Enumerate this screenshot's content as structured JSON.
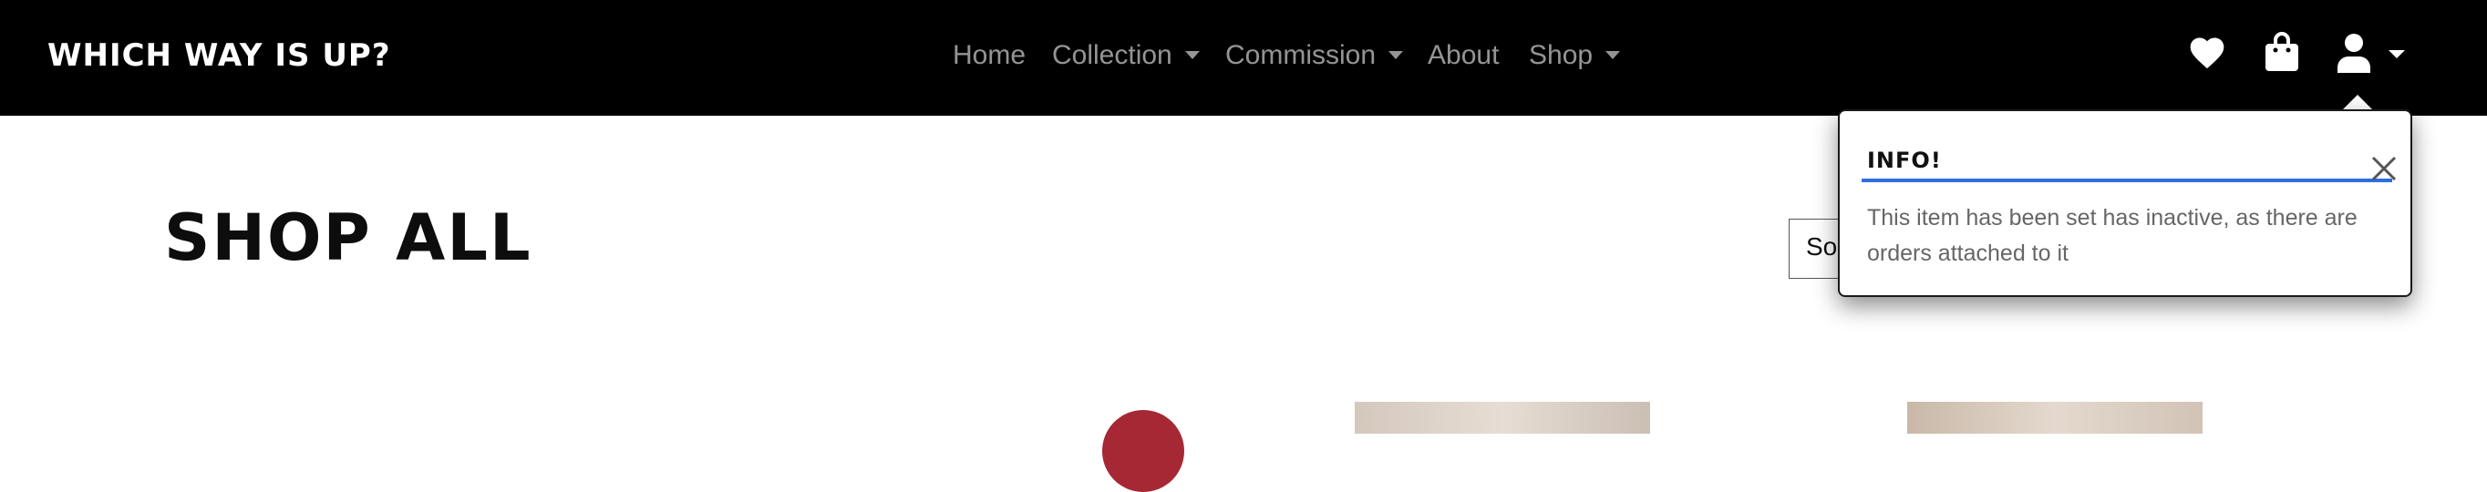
{
  "navbar": {
    "brand": "Which Way Is Up?",
    "links": [
      {
        "label": "Home",
        "dropdown": false
      },
      {
        "label": "Collection",
        "dropdown": true
      },
      {
        "label": "Commission",
        "dropdown": true
      },
      {
        "label": "About",
        "dropdown": false
      },
      {
        "label": "Shop",
        "dropdown": true
      }
    ],
    "icons": [
      "heart-icon",
      "shopping-bag-icon",
      "user-icon"
    ]
  },
  "page": {
    "title": "Shop All",
    "sort_select_visible_text": "So"
  },
  "toast": {
    "title": "Info!",
    "message": "This item has been set has inactive, as there are orders attached to it",
    "accent_color": "#2d6ee0"
  },
  "colors": {
    "navbar_bg": "#000000",
    "badge": "#a52834"
  }
}
